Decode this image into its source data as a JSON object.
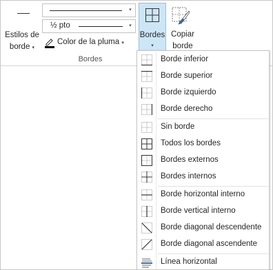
{
  "ribbon": {
    "border_styles": {
      "line1": "Estilos de",
      "line2": "borde",
      "caret": "▾"
    },
    "line_style_dropdown": {
      "caret": "▾"
    },
    "line_weight_dropdown": {
      "value": "½ pto",
      "caret": "▾"
    },
    "pen_color": {
      "label": "Color de la pluma",
      "caret": "▾"
    },
    "group_label": "Bordes",
    "borders_button": {
      "label": "Bordes",
      "caret": "▾"
    },
    "border_painter": {
      "line1": "Copiar",
      "line2": "borde"
    }
  },
  "menu": {
    "items": [
      {
        "label": "Borde inferior",
        "icon": "border-bottom-icon"
      },
      {
        "label": "Borde superior",
        "icon": "border-top-icon"
      },
      {
        "label": "Borde izquierdo",
        "icon": "border-left-icon"
      },
      {
        "label": "Borde derecho",
        "icon": "border-right-icon"
      },
      {
        "label": "Sin borde",
        "icon": "no-border-icon"
      },
      {
        "label": "Todos los bordes",
        "icon": "all-borders-icon"
      },
      {
        "label": "Bordes externos",
        "icon": "outside-borders-icon"
      },
      {
        "label": "Bordes internos",
        "icon": "inside-borders-icon"
      },
      {
        "label": "Borde horizontal interno",
        "icon": "inside-horizontal-border-icon"
      },
      {
        "label": "Borde vertical interno",
        "icon": "inside-vertical-border-icon"
      },
      {
        "label": "Borde diagonal descendente",
        "icon": "diagonal-down-border-icon"
      },
      {
        "label": "Borde diagonal ascendente",
        "icon": "diagonal-up-border-icon"
      },
      {
        "label": "Línea horizontal",
        "icon": "horizontal-line-icon"
      }
    ]
  },
  "colors": {
    "accent_bg": "#cde6f7",
    "accent_border": "#92c0e0",
    "icon_blue": "#3a6ea5"
  }
}
